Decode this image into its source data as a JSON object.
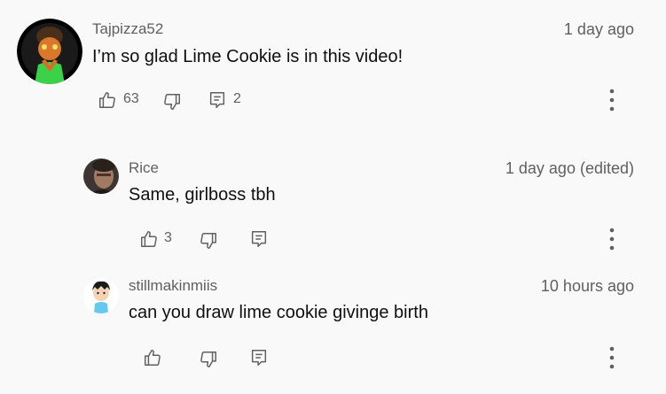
{
  "comments": [
    {
      "author": "Tajpizza52",
      "time": "1 day ago",
      "text": "I’m so glad Lime Cookie is in this video!",
      "likes": "63",
      "replies": "2"
    },
    {
      "author": "Rice",
      "time": "1 day ago (edited)",
      "text": "Same, girlboss tbh",
      "likes": "3"
    },
    {
      "author": "stillmakinmiis",
      "time": "10 hours ago",
      "text": "can you draw lime cookie givinge birth"
    }
  ],
  "colors": {
    "background": "#f9f9f9",
    "text_primary": "#0f0f0f",
    "text_secondary": "#606060",
    "icon": "#606060"
  },
  "icons": {
    "like": "thumb-up-icon",
    "dislike": "thumb-down-icon",
    "reply": "reply-comment-icon",
    "more": "vertical-dots-icon"
  }
}
